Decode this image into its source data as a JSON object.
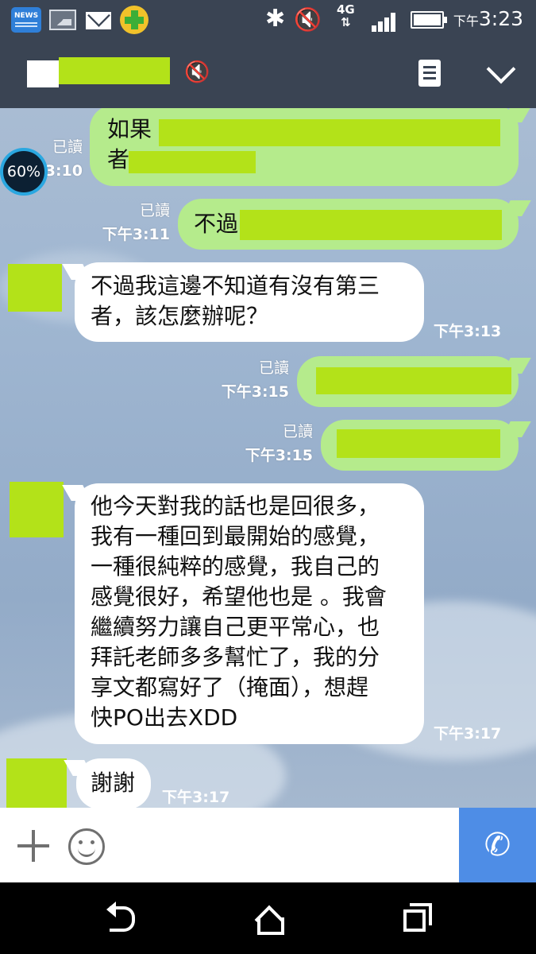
{
  "status_bar": {
    "news_label": "NEWS",
    "network": "4G",
    "time_prefix": "下午",
    "time": "3:23",
    "icons": [
      "news-icon",
      "gallery-icon",
      "mail-icon",
      "security-plus-icon",
      "bluetooth-icon",
      "mute-speaker-icon",
      "network-4g-icon",
      "signal-icon",
      "battery-icon"
    ]
  },
  "header": {
    "icons": [
      "chat-muted-icon",
      "note-icon",
      "chevron-down-icon"
    ]
  },
  "overlay": {
    "battery_percent": "60%"
  },
  "messages": [
    {
      "side": "out",
      "line1": "如果",
      "line2": "者",
      "read": "已讀",
      "time": "3:10"
    },
    {
      "side": "out",
      "line1": "不過",
      "read": "已讀",
      "time": "下午3:11"
    },
    {
      "side": "in",
      "lines": [
        "不過我這邊不知道有沒有第三",
        "者，該怎麼辦呢？"
      ],
      "time": "下午3:13"
    },
    {
      "side": "out",
      "line1": "",
      "read": "已讀",
      "time": "下午3:15"
    },
    {
      "side": "out",
      "line1": "",
      "read": "已讀",
      "time": "下午3:15"
    },
    {
      "side": "in",
      "lines": [
        "他今天對我的話也是回很多，",
        "我有一種回到最開始的感覺，",
        "一種很純粹的感覺，我自己的",
        "感覺很好，希望他也是 。我會",
        "繼續努力讓自己更平常心，也",
        "拜託老師多多幫忙了，我的分",
        "享文都寫好了（掩面），想趕",
        "快PO出去XDD"
      ],
      "time": "下午3:17"
    },
    {
      "side": "in",
      "lines": [
        "謝謝"
      ],
      "time": "下午3:17"
    }
  ],
  "input_bar": {
    "icons": [
      "plus-icon",
      "emoji-icon",
      "phone-icon"
    ],
    "accent": "#4e8de6"
  },
  "colors": {
    "outgoing_bubble": "#b5eb8c",
    "incoming_bubble": "#ffffff",
    "redaction": "#b3e219",
    "header": "#3a4453"
  }
}
